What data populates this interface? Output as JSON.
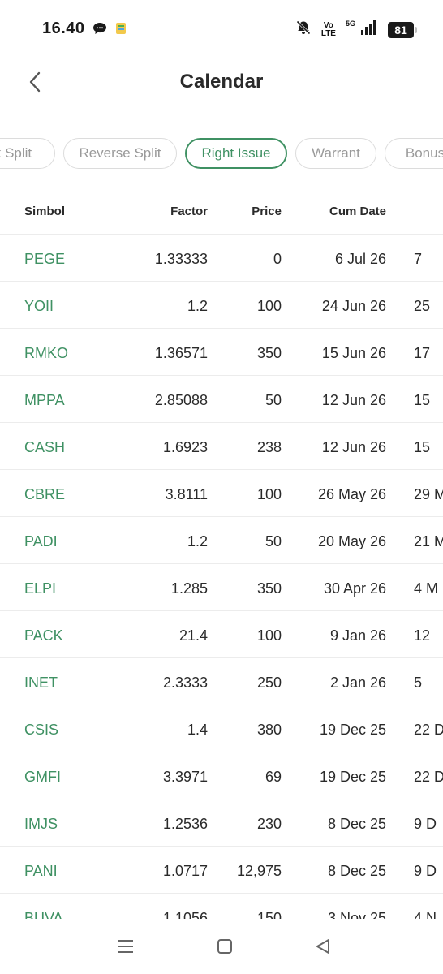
{
  "status": {
    "time": "16.40",
    "volte_top": "Vo",
    "volte_bottom": "LTE",
    "network": "5G",
    "battery": "81"
  },
  "header": {
    "title": "Calendar"
  },
  "chips": [
    {
      "label": "Stock Split",
      "active": false
    },
    {
      "label": "Reverse Split",
      "active": false
    },
    {
      "label": "Right Issue",
      "active": true
    },
    {
      "label": "Warrant",
      "active": false
    },
    {
      "label": "Bonus",
      "active": false
    }
  ],
  "table": {
    "columns": [
      "Simbol",
      "Factor",
      "Price",
      "Cum Date"
    ],
    "rows": [
      {
        "symbol": "PEGE",
        "factor": "1.33333",
        "price": "0",
        "cum_date": "6 Jul 26",
        "ex_date": "7"
      },
      {
        "symbol": "YOII",
        "factor": "1.2",
        "price": "100",
        "cum_date": "24 Jun 26",
        "ex_date": "25"
      },
      {
        "symbol": "RMKO",
        "factor": "1.36571",
        "price": "350",
        "cum_date": "15 Jun 26",
        "ex_date": "17"
      },
      {
        "symbol": "MPPA",
        "factor": "2.85088",
        "price": "50",
        "cum_date": "12 Jun 26",
        "ex_date": "15"
      },
      {
        "symbol": "CASH",
        "factor": "1.6923",
        "price": "238",
        "cum_date": "12 Jun 26",
        "ex_date": "15"
      },
      {
        "symbol": "CBRE",
        "factor": "3.8111",
        "price": "100",
        "cum_date": "26 May 26",
        "ex_date": "29 M"
      },
      {
        "symbol": "PADI",
        "factor": "1.2",
        "price": "50",
        "cum_date": "20 May 26",
        "ex_date": "21 M"
      },
      {
        "symbol": "ELPI",
        "factor": "1.285",
        "price": "350",
        "cum_date": "30 Apr 26",
        "ex_date": "4 M"
      },
      {
        "symbol": "PACK",
        "factor": "21.4",
        "price": "100",
        "cum_date": "9 Jan 26",
        "ex_date": "12"
      },
      {
        "symbol": "INET",
        "factor": "2.3333",
        "price": "250",
        "cum_date": "2 Jan 26",
        "ex_date": "5"
      },
      {
        "symbol": "CSIS",
        "factor": "1.4",
        "price": "380",
        "cum_date": "19 Dec 25",
        "ex_date": "22 D"
      },
      {
        "symbol": "GMFI",
        "factor": "3.3971",
        "price": "69",
        "cum_date": "19 Dec 25",
        "ex_date": "22 D"
      },
      {
        "symbol": "IMJS",
        "factor": "1.2536",
        "price": "230",
        "cum_date": "8 Dec 25",
        "ex_date": "9 D"
      },
      {
        "symbol": "PANI",
        "factor": "1.0717",
        "price": "12,975",
        "cum_date": "8 Dec 25",
        "ex_date": "9 D"
      },
      {
        "symbol": "BUVA",
        "factor": "1.1056",
        "price": "150",
        "cum_date": "3 Nov 25",
        "ex_date": "4 N"
      }
    ]
  },
  "colors": {
    "accent": "#3f9163",
    "text": "#2a2a2a",
    "muted": "#9a9a9a",
    "border": "#ececec"
  },
  "icons": {
    "back": "chevron-left-icon",
    "chat": "chat-bubble-icon",
    "notif_app": "app-notification-icon",
    "mute": "bell-off-icon",
    "signal": "signal-bars-icon",
    "nav_menu": "menu-icon",
    "nav_home": "home-square-icon",
    "nav_back": "back-triangle-icon"
  }
}
